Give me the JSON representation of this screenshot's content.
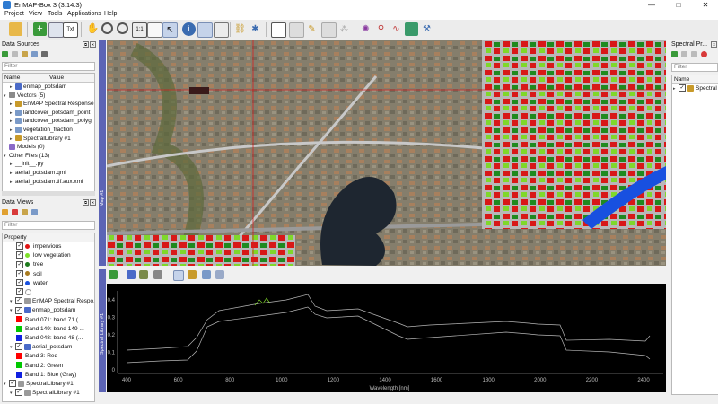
{
  "window": {
    "title": "EnMAP-Box 3 (3.14.3)",
    "controls": [
      "—",
      "□",
      "✕"
    ]
  },
  "menu": [
    "Project",
    "View",
    "Tools",
    "Applications",
    "Help"
  ],
  "toolbar": {
    "text_button": "Txt"
  },
  "data_sources": {
    "title": "Data Sources",
    "filter_placeholder": "Filter",
    "columns": [
      "Name",
      "Value"
    ],
    "items": [
      {
        "label": "enmap_potsdam",
        "indent": 1,
        "expander": "▸",
        "icon": "raster"
      },
      {
        "label": "Vectors (5)",
        "indent": 0,
        "expander": "▾",
        "icon": "vector-group"
      },
      {
        "label": "EnMAP Spectral Response",
        "indent": 1,
        "expander": "▸",
        "icon": "library"
      },
      {
        "label": "landcover_potsdam_point",
        "indent": 1,
        "expander": "▸",
        "icon": "vector"
      },
      {
        "label": "landcover_potsdam_polyg",
        "indent": 1,
        "expander": "▸",
        "icon": "vector"
      },
      {
        "label": "vegetation_fraction",
        "indent": 1,
        "expander": "▸",
        "icon": "vector"
      },
      {
        "label": "SpectralLibrary #1",
        "indent": 1,
        "expander": "▸",
        "icon": "library"
      },
      {
        "label": "Models (0)",
        "indent": 0,
        "expander": "",
        "icon": "model"
      },
      {
        "label": "Other Files (13)",
        "indent": 0,
        "expander": "▾",
        "icon": ""
      },
      {
        "label": "__init__.py",
        "indent": 1,
        "expander": "▸",
        "icon": ""
      },
      {
        "label": "aerial_potsdam.qml",
        "indent": 1,
        "expander": "▸",
        "icon": ""
      },
      {
        "label": "aerial_potsdam.tif.aux.xml",
        "indent": 1,
        "expander": "▸",
        "icon": ""
      }
    ]
  },
  "data_views": {
    "title": "Data Views",
    "filter_placeholder": "Filter",
    "column": "Property",
    "items": [
      {
        "label": "impervious",
        "type": "class",
        "color": "#e01414",
        "indent": 2
      },
      {
        "label": "low vegetation",
        "type": "class",
        "color": "#7ee02a",
        "indent": 2
      },
      {
        "label": "tree",
        "type": "class",
        "color": "#1c7a1c",
        "indent": 2
      },
      {
        "label": "soil",
        "type": "class",
        "color": "#a87a1e",
        "indent": 2
      },
      {
        "label": "water",
        "type": "class",
        "color": "#1850e0",
        "indent": 2
      },
      {
        "label": "",
        "type": "class",
        "color": "#ffffff",
        "indent": 2
      },
      {
        "label": "EnMAP Spectral Respo...",
        "type": "layer",
        "color": "#9a9a9a",
        "indent": 1
      },
      {
        "label": "enmap_potsdam",
        "type": "layer",
        "color": "#4a6ac8",
        "indent": 1
      },
      {
        "label": "Band 071: band 71 (...",
        "type": "band",
        "color": "#ff0000",
        "indent": 2
      },
      {
        "label": "Band 149: band 149 ...",
        "type": "band",
        "color": "#00c800",
        "indent": 2
      },
      {
        "label": "Band 048: band 48 (...",
        "type": "band",
        "color": "#1020e0",
        "indent": 2
      },
      {
        "label": "aerial_potsdam",
        "type": "layer",
        "color": "#4a6ac8",
        "indent": 1
      },
      {
        "label": "Band 3: Red",
        "type": "band",
        "color": "#ff0000",
        "indent": 2
      },
      {
        "label": "Band 2: Green",
        "type": "band",
        "color": "#00c800",
        "indent": 2
      },
      {
        "label": "Band 1: Blue (Gray)",
        "type": "band",
        "color": "#1020e0",
        "indent": 2
      },
      {
        "label": "SpectralLibrary #1",
        "type": "root",
        "color": "#9a9a9a",
        "indent": 0
      },
      {
        "label": "SpectralLibrary #1",
        "type": "layer",
        "color": "#9a9a9a",
        "indent": 1
      }
    ]
  },
  "spectral_profiles": {
    "title": "Spectral Pr...",
    "filter_placeholder": "Filter",
    "column": "Name",
    "item": "Spectral"
  },
  "map_view": {
    "label": "Map #1"
  },
  "spectral_view": {
    "label": "Spectral Library #1",
    "xlabel": "Wavelength [nm]",
    "x_ticks": [
      400,
      600,
      800,
      1000,
      1200,
      1400,
      1600,
      1800,
      2000,
      2200,
      2400
    ],
    "y_ticks": [
      0,
      0.1,
      0.2,
      0.3,
      0.4
    ]
  }
}
